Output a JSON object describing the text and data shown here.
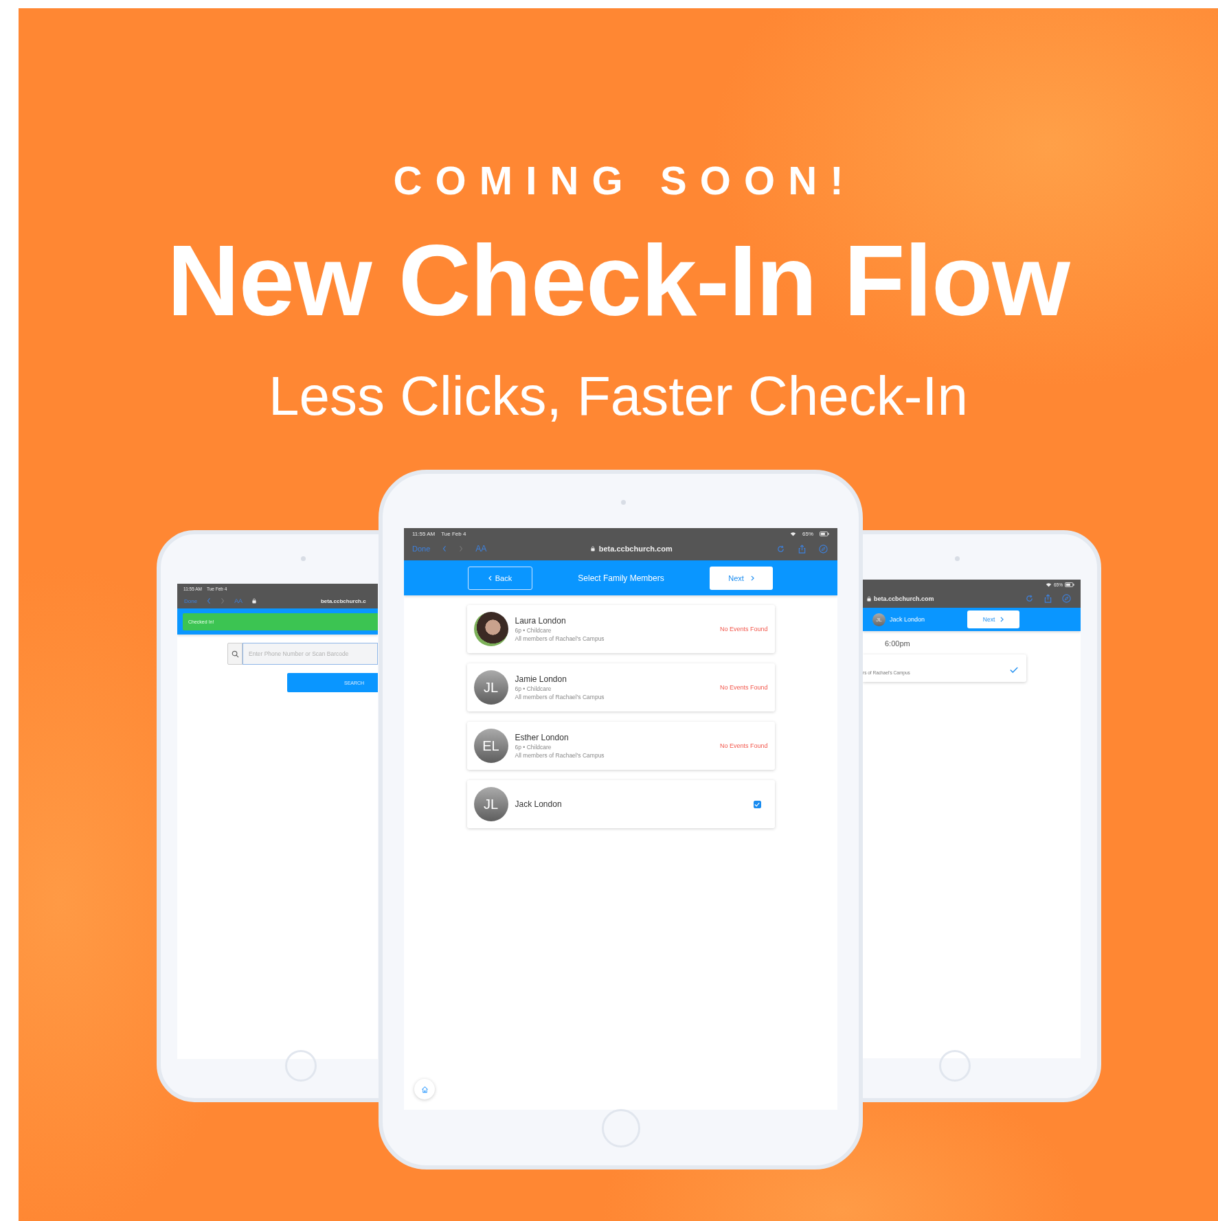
{
  "headline": {
    "kicker": "COMING SOON!",
    "title": "New Check-In Flow",
    "subtitle": "Less Clicks, Faster Check-In"
  },
  "left_tablet": {
    "status_bar": {
      "time": "11:55 AM",
      "date": "Tue Feb 4"
    },
    "browser": {
      "done": "Done",
      "text_size": "AA",
      "url": "beta.ccbchurch.c"
    },
    "banner": "Checked In!",
    "search": {
      "placeholder": "Enter Phone Number or Scan Barcode"
    },
    "search_button": "SEARCH"
  },
  "center_tablet": {
    "status_bar": {
      "time": "11:55 AM",
      "date": "Tue Feb 4",
      "battery": "65%"
    },
    "browser": {
      "done": "Done",
      "text_size": "AA",
      "url": "beta.ccbchurch.com"
    },
    "header": {
      "back": "Back",
      "title": "Select Family Members",
      "next": "Next"
    },
    "members": [
      {
        "kind": "photo",
        "name": "Laura London",
        "details": "6p • Childcare",
        "group": "All members of Rachael's Campus",
        "status": "No Events Found"
      },
      {
        "kind": "initials",
        "initials": "JL",
        "name": "Jamie London",
        "details": "6p • Childcare",
        "group": "All members of Rachael's Campus",
        "status": "No Events Found"
      },
      {
        "kind": "initials",
        "initials": "EL",
        "name": "Esther London",
        "details": "6p • Childcare",
        "group": "All members of Rachael's Campus",
        "status": "No Events Found"
      },
      {
        "kind": "initials",
        "initials": "JL",
        "name": "Jack London",
        "checked": true
      }
    ]
  },
  "right_tablet": {
    "status_bar": {
      "battery": "65%"
    },
    "browser": {
      "url": "beta.ccbchurch.com"
    },
    "header": {
      "initials": "JL",
      "name": "Jack London",
      "next": "Next"
    },
    "time": "6:00pm",
    "event": {
      "group": "rs of Rachael's Campus",
      "checked": true
    }
  }
}
